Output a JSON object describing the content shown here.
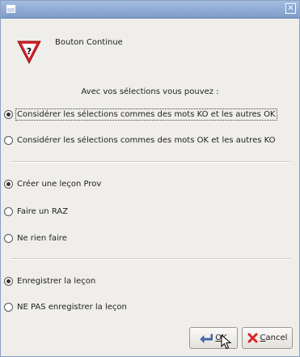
{
  "window": {
    "close_glyph": "✕"
  },
  "dialog": {
    "title": "Bouton Continue",
    "icon": "warning-question-icon",
    "heading": "Avec vos sélections vous pouvez :"
  },
  "group1": [
    {
      "label": "Considérer les sélections commes des mots KO et les autres OK",
      "checked": true
    },
    {
      "label": "Considérer les sélections commes des mots OK et les autres KO",
      "checked": false
    }
  ],
  "group2": [
    {
      "label": "Créer une leçon Prov",
      "checked": true
    },
    {
      "label": "Faire un RAZ",
      "checked": false
    },
    {
      "label": "Ne rien faire",
      "checked": false
    }
  ],
  "group3": [
    {
      "label": "Enregistrer la leçon",
      "checked": true
    },
    {
      "label": "NE PAS enregistrer la leçon",
      "checked": false
    }
  ],
  "buttons": {
    "ok_mnemonic": "O",
    "ok_rest": "K",
    "cancel_mnemonic": "C",
    "cancel_rest": "ancel"
  },
  "colors": {
    "titlebar": "#7d9cc9",
    "warning_red": "#d8232a"
  }
}
